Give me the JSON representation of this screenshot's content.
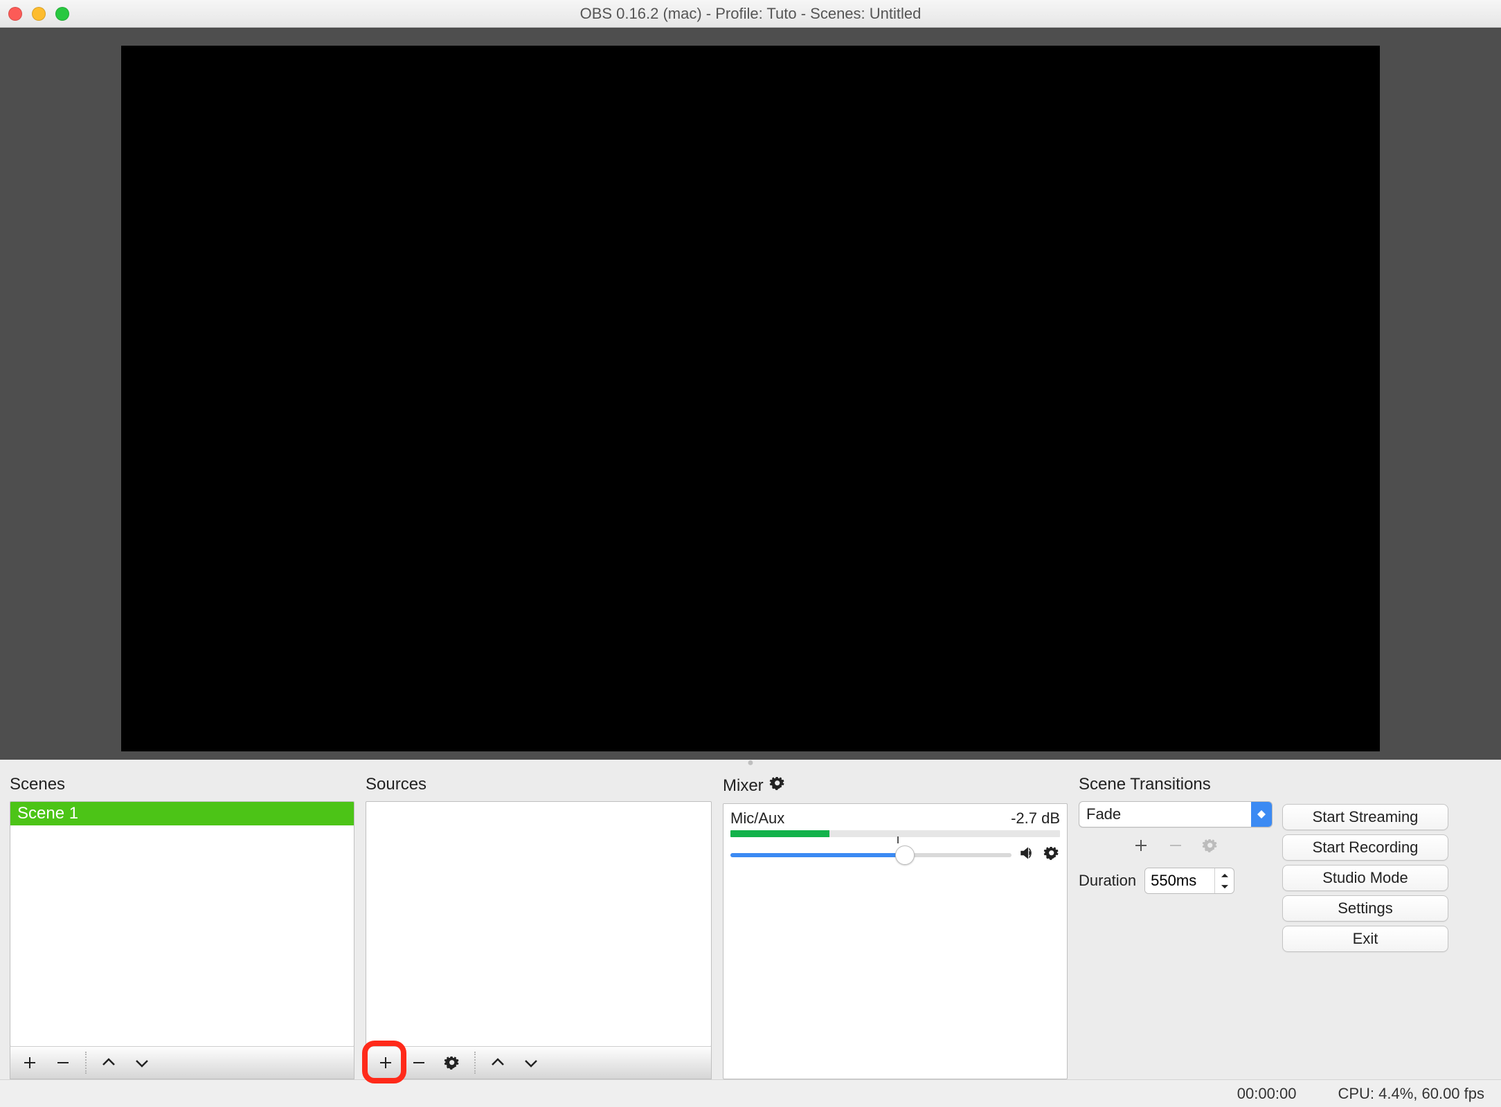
{
  "window": {
    "title": "OBS 0.16.2 (mac) - Profile: Tuto - Scenes: Untitled"
  },
  "panels": {
    "scenes": {
      "title": "Scenes",
      "items": [
        "Scene 1"
      ]
    },
    "sources": {
      "title": "Sources"
    },
    "mixer": {
      "title": "Mixer",
      "channel_name": "Mic/Aux",
      "channel_level": "-2.7 dB"
    },
    "transitions": {
      "title": "Scene Transitions",
      "selected": "Fade",
      "duration_label": "Duration",
      "duration_value": "550ms"
    }
  },
  "buttons": {
    "start_streaming": "Start Streaming",
    "start_recording": "Start Recording",
    "studio_mode": "Studio Mode",
    "settings": "Settings",
    "exit": "Exit"
  },
  "status": {
    "time": "00:00:00",
    "cpu": "CPU: 4.4%, 60.00 fps"
  }
}
